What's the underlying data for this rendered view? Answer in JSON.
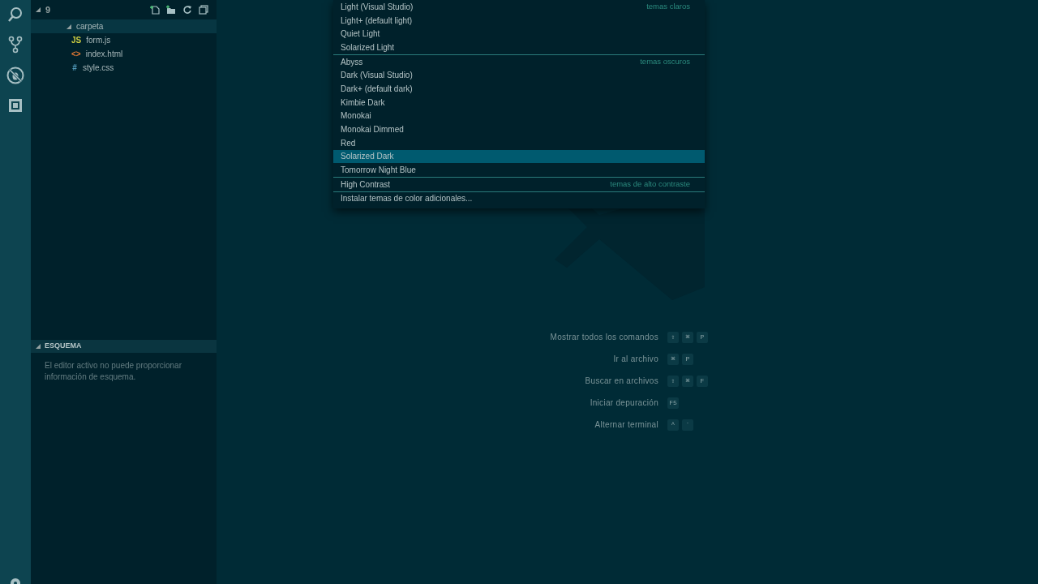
{
  "explorer": {
    "folder": "9",
    "expanded": true,
    "items": [
      {
        "name": "carpeta",
        "kind": "folder",
        "expanded": true,
        "selected": true
      },
      {
        "name": "form.js",
        "kind": "file",
        "icon": "JS",
        "color": "#cbcb41",
        "selected": false
      },
      {
        "name": "index.html",
        "kind": "file",
        "icon": "<>",
        "color": "#e37933",
        "selected": false
      },
      {
        "name": "style.css",
        "kind": "file",
        "icon": "#",
        "color": "#519aba",
        "selected": false
      }
    ]
  },
  "outline": {
    "title": "ESQUEMA",
    "expanded": true,
    "message": "El editor activo no puede proporcionar información de esquema."
  },
  "theme_picker": {
    "groups": [
      {
        "label": "temas claros",
        "items": [
          {
            "name": "Light (Visual Studio)",
            "selected": false
          },
          {
            "name": "Light+ (default light)",
            "selected": false
          },
          {
            "name": "Quiet Light",
            "selected": false
          },
          {
            "name": "Solarized Light",
            "selected": false
          }
        ]
      },
      {
        "label": "temas oscuros",
        "items": [
          {
            "name": "Abyss",
            "selected": false
          },
          {
            "name": "Dark (Visual Studio)",
            "selected": false
          },
          {
            "name": "Dark+ (default dark)",
            "selected": false
          },
          {
            "name": "Kimbie Dark",
            "selected": false
          },
          {
            "name": "Monokai",
            "selected": false
          },
          {
            "name": "Monokai Dimmed",
            "selected": false
          },
          {
            "name": "Red",
            "selected": false
          },
          {
            "name": "Solarized Dark",
            "selected": true
          },
          {
            "name": "Tomorrow Night Blue",
            "selected": false
          }
        ]
      },
      {
        "label": "temas de alto contraste",
        "items": [
          {
            "name": "High Contrast",
            "selected": false
          }
        ]
      },
      {
        "items": [
          {
            "name": "Instalar temas de color adicionales...",
            "selected": false
          }
        ]
      }
    ]
  },
  "shortcuts": [
    {
      "label": "Mostrar todos los comandos",
      "keys": [
        "⇧",
        "⌘",
        "P"
      ]
    },
    {
      "label": "Ir al archivo",
      "keys": [
        "⌘",
        "P"
      ]
    },
    {
      "label": "Buscar en archivos",
      "keys": [
        "⇧",
        "⌘",
        "F"
      ]
    },
    {
      "label": "Iniciar depuración",
      "keys": [
        "F5"
      ]
    },
    {
      "label": "Alternar terminal",
      "keys": [
        "^",
        "`"
      ]
    }
  ]
}
